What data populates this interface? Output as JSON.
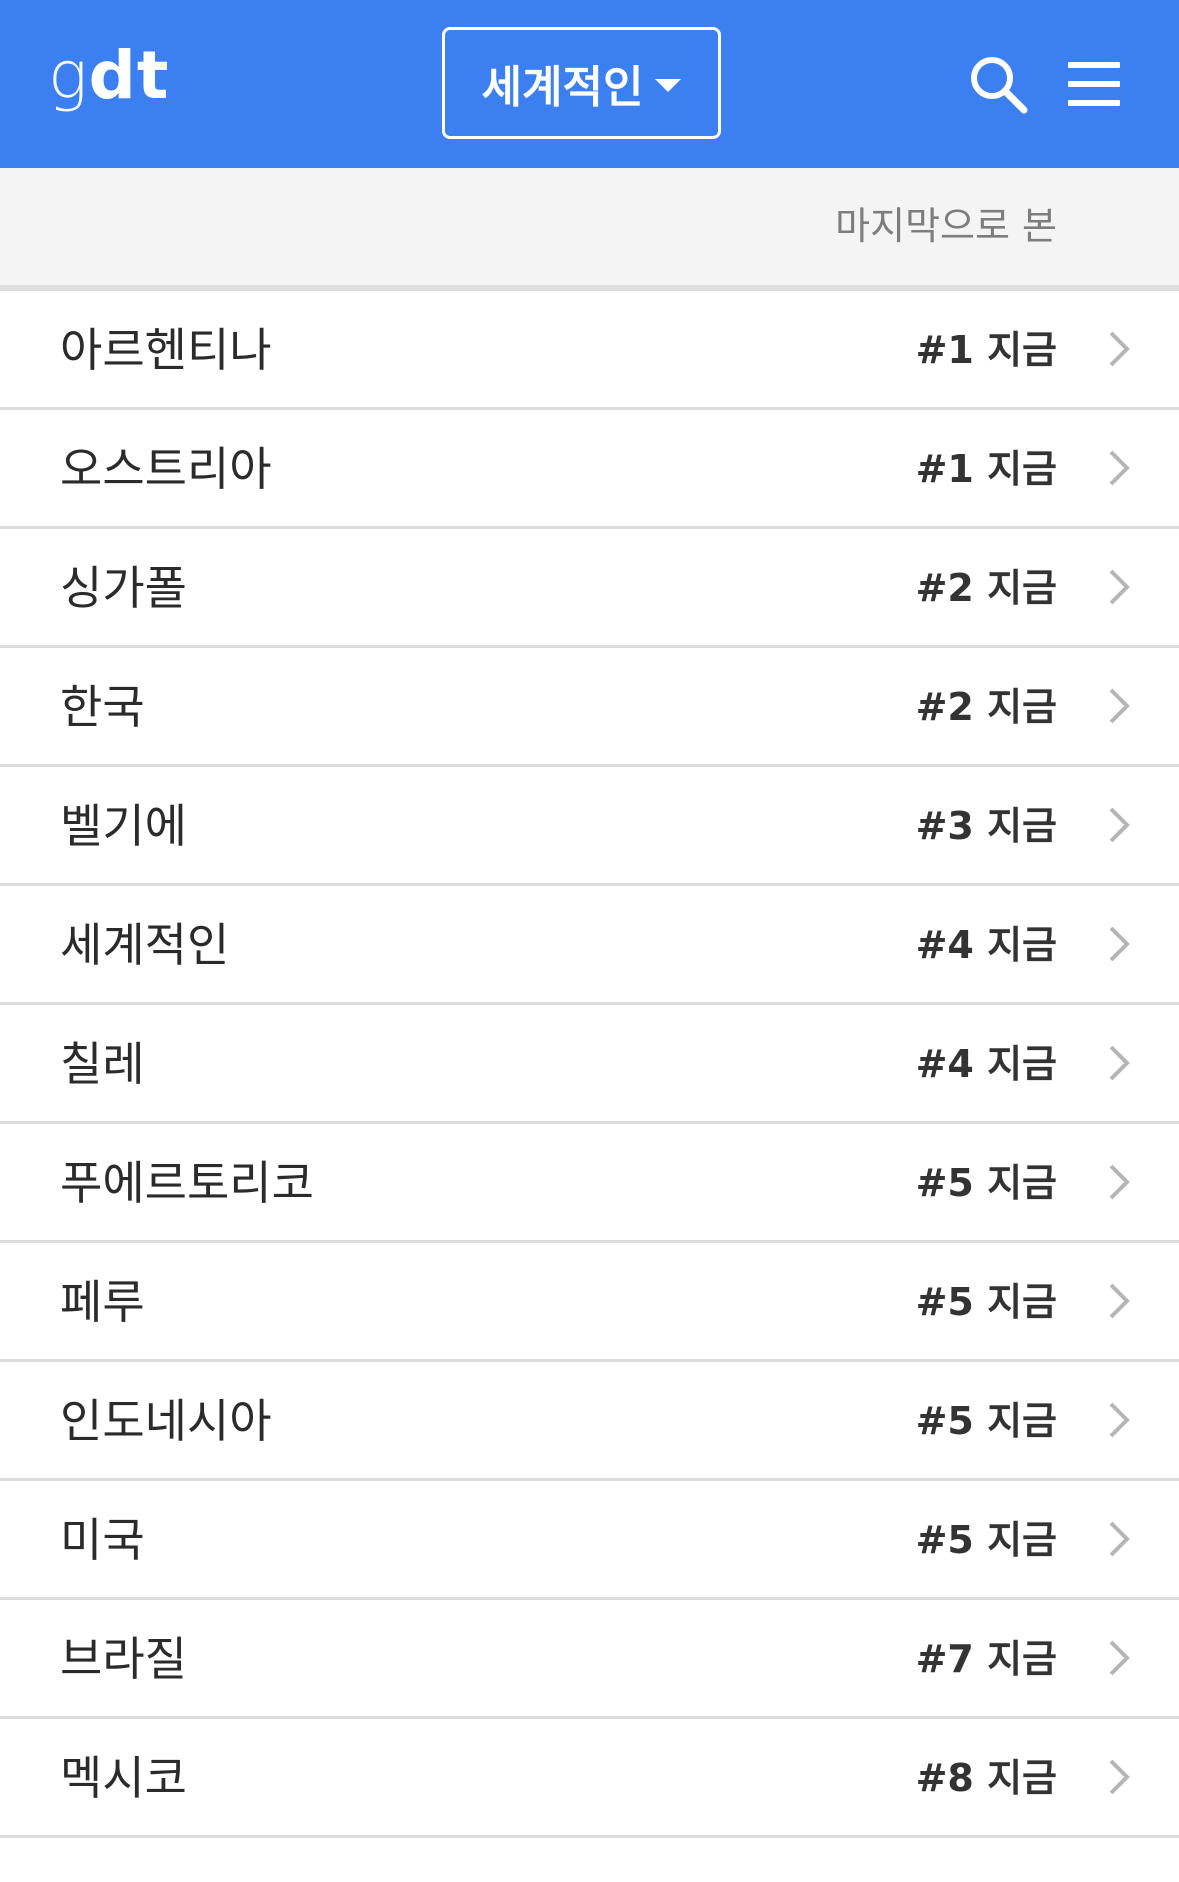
{
  "header": {
    "logo_g": "g",
    "logo_dt": "dt",
    "region_label": "세계적인",
    "search_icon": "search-icon",
    "menu_icon": "hamburger-menu-icon",
    "accent_color": "#3b7ff0"
  },
  "subbar": {
    "last_viewed": "마지막으로 본"
  },
  "list": {
    "items": [
      {
        "name": "아르헨티나",
        "rank": "#1 지금"
      },
      {
        "name": "오스트리아",
        "rank": "#1 지금"
      },
      {
        "name": "싱가폴",
        "rank": "#2 지금"
      },
      {
        "name": "한국",
        "rank": "#2 지금"
      },
      {
        "name": "벨기에",
        "rank": "#3 지금"
      },
      {
        "name": "세계적인",
        "rank": "#4 지금"
      },
      {
        "name": "칠레",
        "rank": "#4 지금"
      },
      {
        "name": "푸에르토리코",
        "rank": "#5 지금"
      },
      {
        "name": "페루",
        "rank": "#5 지금"
      },
      {
        "name": "인도네시아",
        "rank": "#5 지금"
      },
      {
        "name": "미국",
        "rank": "#5 지금"
      },
      {
        "name": "브라질",
        "rank": "#7 지금"
      },
      {
        "name": "멕시코",
        "rank": "#8 지금"
      }
    ]
  }
}
